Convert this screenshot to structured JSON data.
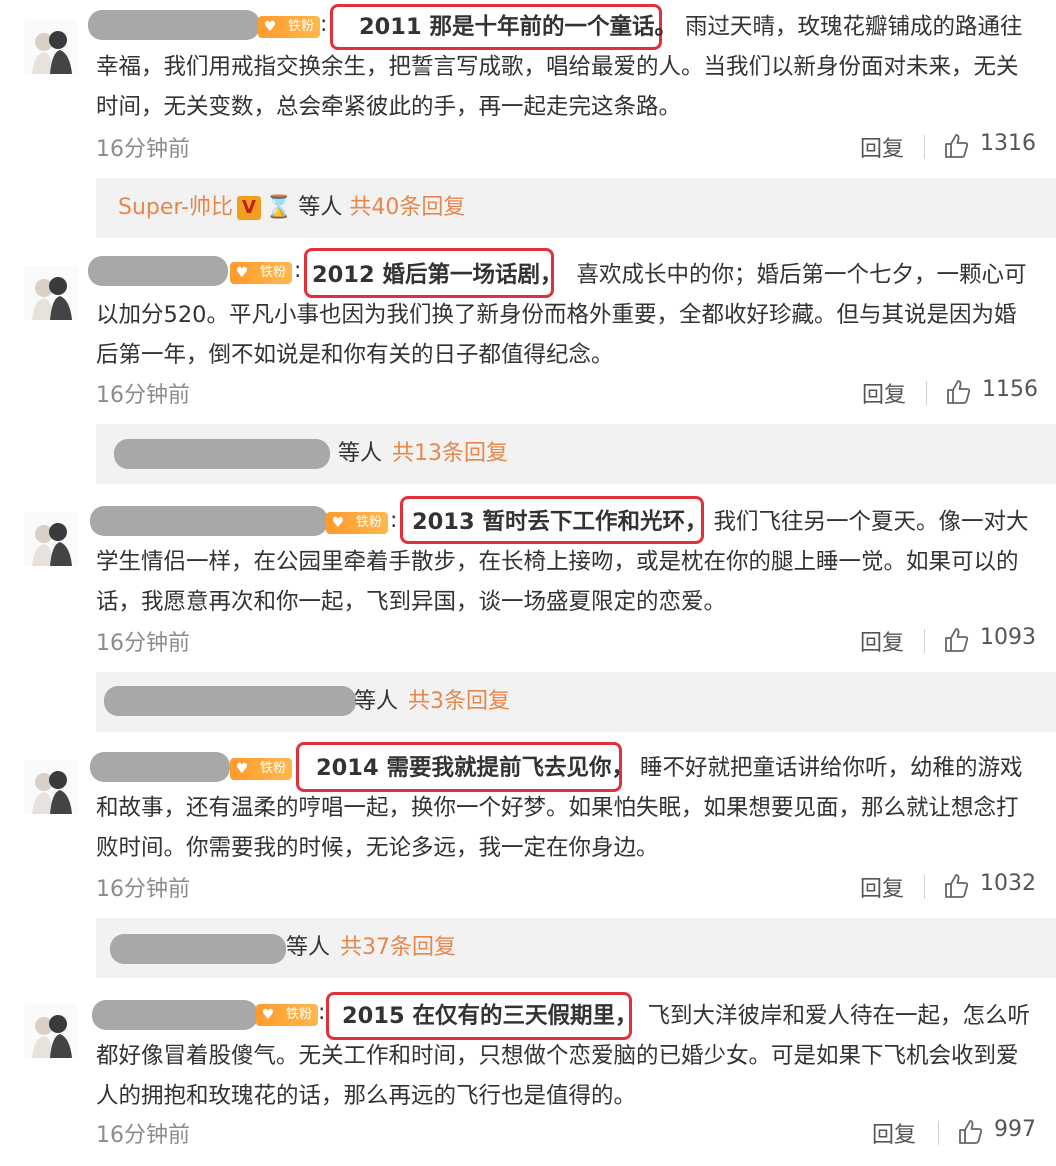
{
  "comments": [
    {
      "badge": "铁粉",
      "highlight": "2011 那是十年前的一个童话。",
      "text_rest": "雨过天晴，玫瑰花瓣铺成的路通往幸福，我们用戒指交换余生，把誓言写成歌，唱给最爱的人。当我们以新身份面对未来，无关时间，无关变数，总会牵紧彼此的手，再一起走完这条路。",
      "time": "16分钟前",
      "reply_label": "回复",
      "likes": "1316",
      "replies_user": "Super-帅比",
      "replies_suffix": "等人",
      "replies_count": "共40条回复"
    },
    {
      "badge": "铁粉",
      "highlight": "2012 婚后第一场话剧，",
      "text_rest": "喜欢成长中的你；婚后第一个七夕，一颗心可以加分520。平凡小事也因为我们换了新身份而格外重要，全都收好珍藏。但与其说是因为婚后第一年，倒不如说是和你有关的日子都值得纪念。",
      "time": "16分钟前",
      "reply_label": "回复",
      "likes": "1156",
      "replies_suffix": "等人",
      "replies_count": "共13条回复"
    },
    {
      "badge": "铁粉",
      "highlight": "2013 暂时丢下工作和光环，",
      "text_rest": "我们飞往另一个夏天。像一对大学生情侣一样，在公园里牵着手散步，在长椅上接吻，或是枕在你的腿上睡一觉。如果可以的话，我愿意再次和你一起，飞到异国，谈一场盛夏限定的恋爱。",
      "time": "16分钟前",
      "reply_label": "回复",
      "likes": "1093",
      "replies_suffix": "等人",
      "replies_count": "共3条回复"
    },
    {
      "badge": "铁粉",
      "highlight": "2014 需要我就提前飞去见你，",
      "text_rest": "睡不好就把童话讲给你听，幼稚的游戏和故事，还有温柔的哼唱一起，换你一个好梦。如果怕失眠，如果想要见面，那么就让想念打败时间。你需要我的时候，无论多远，我一定在你身边。",
      "time": "16分钟前",
      "reply_label": "回复",
      "likes": "1032",
      "replies_suffix": "等人",
      "replies_count": "共37条回复"
    },
    {
      "badge": "铁粉",
      "highlight": "2015 在仅有的三天假期里，",
      "text_rest": "飞到大洋彼岸和爱人待在一起，怎么听都好像冒着股傻气。无关工作和时间，只想做个恋爱脑的已婚少女。可是如果下飞机会收到爱人的拥抱和玫瑰花的话，那么再远的飞行也是值得的。",
      "time": "16分钟前",
      "reply_label": "回复",
      "likes": "997"
    }
  ],
  "icons": {
    "like": "thumbs-up-icon",
    "badge": "heart-fan-icon",
    "verified": "v-badge-icon",
    "hourglass": "hourglass-icon"
  }
}
